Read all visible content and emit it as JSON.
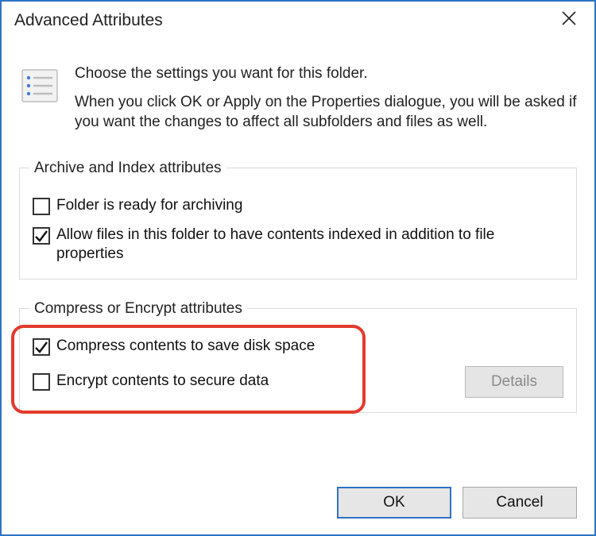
{
  "title": "Advanced Attributes",
  "intro": {
    "heading": "Choose the settings you want for this folder.",
    "body": "When you click OK or Apply on the Properties dialogue, you will be asked if you want the changes to affect all subfolders and files as well."
  },
  "group1": {
    "legend": "Archive and Index attributes",
    "item1": {
      "label": "Folder is ready for archiving",
      "checked": false
    },
    "item2": {
      "label": "Allow files in this folder to have contents indexed in addition to file properties",
      "checked": true
    }
  },
  "group2": {
    "legend": "Compress or Encrypt attributes",
    "item1": {
      "label": "Compress contents to save disk space",
      "checked": true
    },
    "item2": {
      "label": "Encrypt contents to secure data",
      "checked": false
    },
    "details": "Details"
  },
  "buttons": {
    "ok": "OK",
    "cancel": "Cancel"
  }
}
